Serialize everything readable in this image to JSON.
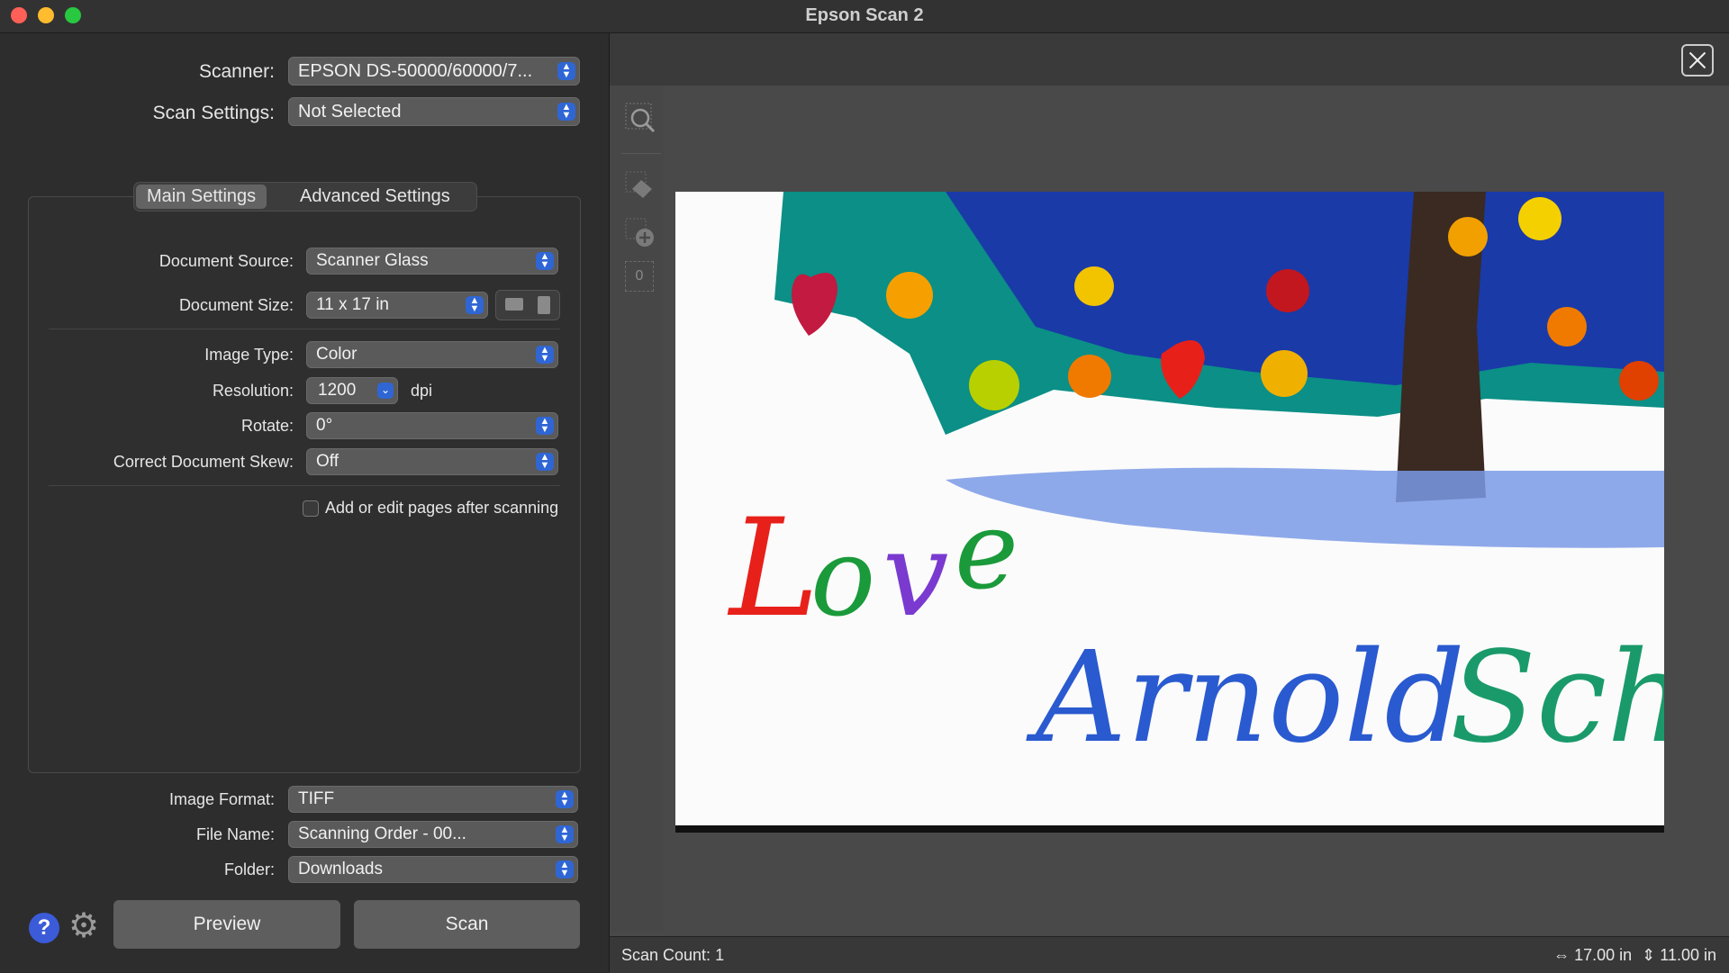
{
  "window": {
    "title": "Epson Scan 2"
  },
  "scanner": {
    "label": "Scanner:",
    "value": "EPSON DS-50000/60000/7..."
  },
  "scan_settings": {
    "label": "Scan Settings:",
    "value": "Not Selected"
  },
  "tabs": [
    {
      "label": "Main Settings",
      "active": true
    },
    {
      "label": "Advanced Settings",
      "active": false
    }
  ],
  "main_settings": {
    "document_source": {
      "label": "Document Source:",
      "value": "Scanner Glass"
    },
    "document_size": {
      "label": "Document Size:",
      "value": "11 x 17 in"
    },
    "image_type": {
      "label": "Image Type:",
      "value": "Color"
    },
    "resolution": {
      "label": "Resolution:",
      "value": "1200",
      "unit": "dpi"
    },
    "rotate": {
      "label": "Rotate:",
      "value": "0°"
    },
    "skew": {
      "label": "Correct Document Skew:",
      "value": "Off"
    },
    "add_pages": {
      "label": "Add or edit pages after scanning",
      "checked": false
    }
  },
  "output": {
    "image_format": {
      "label": "Image Format:",
      "value": "TIFF"
    },
    "file_name": {
      "label": "File Name:",
      "value": "Scanning Order - 00..."
    },
    "folder": {
      "label": "Folder:",
      "value": "Downloads"
    }
  },
  "buttons": {
    "preview": "Preview",
    "scan": "Scan",
    "help": "?"
  },
  "preview": {
    "page_counter": "0"
  },
  "status": {
    "scan_count": "Scan Count: 1",
    "width": "17.00 in",
    "height": "11.00 in"
  },
  "colors": {
    "accent": "#2f66d4",
    "help": "#3b5bd9"
  },
  "icons": [
    "zoom-icon",
    "auto-crop-icon",
    "add-area-icon",
    "page-counter-icon",
    "close-icon",
    "help-icon",
    "gear-icon",
    "width-icon",
    "height-icon"
  ]
}
